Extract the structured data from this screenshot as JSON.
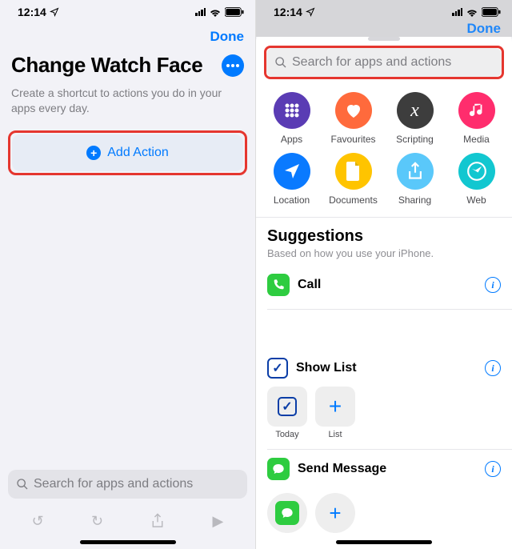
{
  "statusbar": {
    "time": "12:14"
  },
  "left": {
    "done": "Done",
    "title": "Change Watch Face",
    "subtitle": "Create a shortcut to actions you do in your apps every day.",
    "add_action": "Add Action",
    "search_placeholder": "Search for apps and actions"
  },
  "right": {
    "done": "Done",
    "search_placeholder": "Search for apps and actions",
    "categories": [
      {
        "label": "Apps",
        "color": "#5a3cb4",
        "icon": "apps"
      },
      {
        "label": "Favourites",
        "color": "#ff6a3c",
        "icon": "heart"
      },
      {
        "label": "Scripting",
        "color": "#3d3d3d",
        "icon": "script"
      },
      {
        "label": "Media",
        "color": "#ff2d6d",
        "icon": "music"
      },
      {
        "label": "Location",
        "color": "#0a7aff",
        "icon": "location"
      },
      {
        "label": "Documents",
        "color": "#ffc400",
        "icon": "document"
      },
      {
        "label": "Sharing",
        "color": "#5ac8fa",
        "icon": "share"
      },
      {
        "label": "Web",
        "color": "#12c7d0",
        "icon": "web"
      }
    ],
    "suggestions": {
      "heading": "Suggestions",
      "subheading": "Based on how you use your iPhone."
    },
    "items": {
      "call": "Call",
      "show_list": "Show List",
      "send_message": "Send Message",
      "chips": {
        "today": "Today",
        "list": "List"
      }
    }
  }
}
